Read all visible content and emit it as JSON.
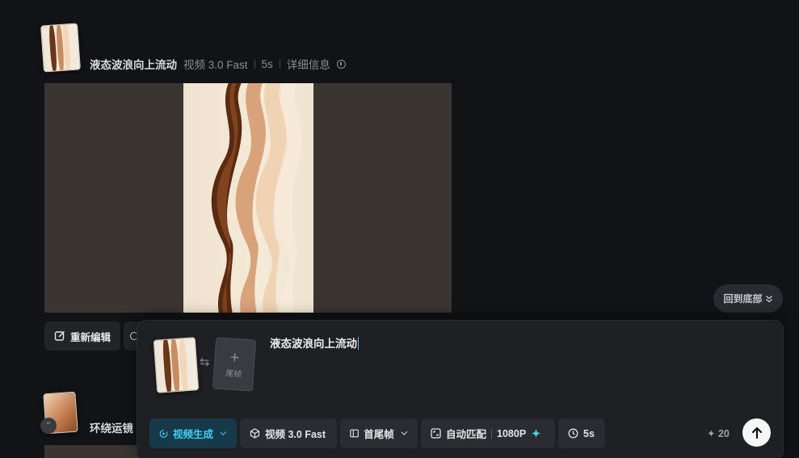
{
  "records": [
    {
      "title": "液态波浪向上流动",
      "model": "视频 3.0 Fast",
      "duration": "5s",
      "details_label": "详细信息",
      "actions": {
        "re_edit": "重新编辑"
      }
    },
    {
      "title": "环绕运镜",
      "badge": "“"
    }
  ],
  "back_to_bottom": "回到底部",
  "composer": {
    "end_frame_label": "尾帧",
    "prompt_text": "液态波浪向上流动",
    "chips": {
      "mode": "视频生成",
      "model": "视频 3.0 Fast",
      "frame_mode": "首尾帧",
      "ratio": "自动匹配",
      "resolution": "1080P",
      "duration": "5s"
    },
    "credits": "✦ 20"
  },
  "colors": {
    "accent": "#3ed1f3",
    "background": "#121316",
    "panel": "#1f2024"
  }
}
